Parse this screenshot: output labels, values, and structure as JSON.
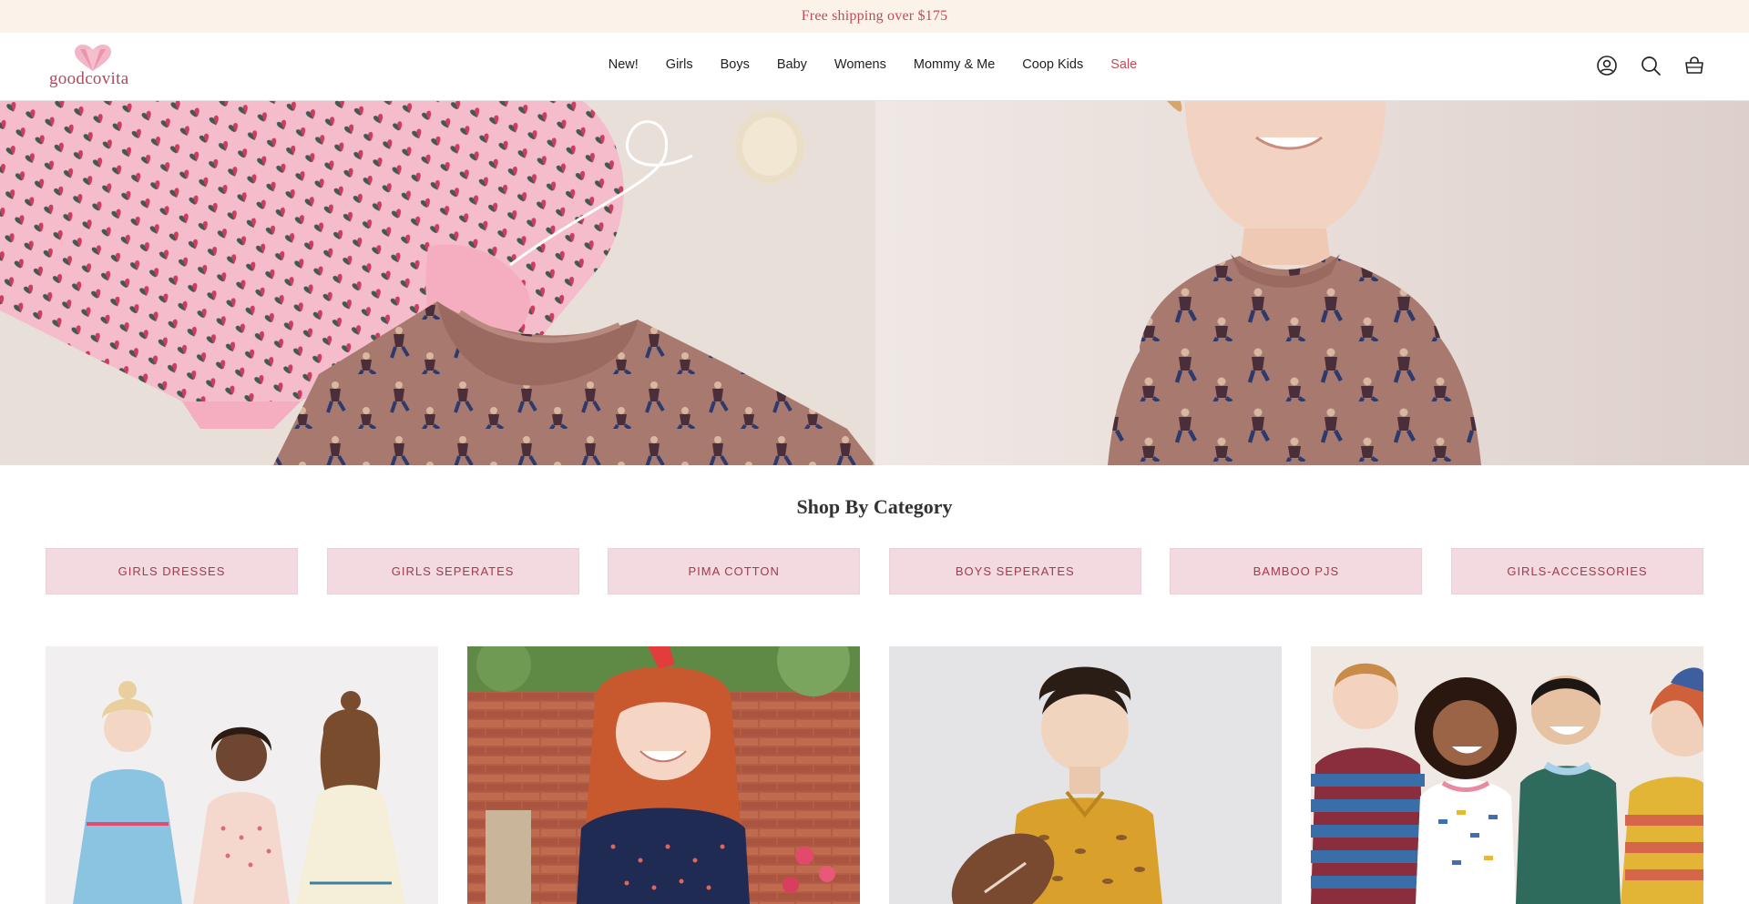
{
  "announcement": {
    "text": "Free shipping over $175"
  },
  "brand": {
    "name": "goodcovita",
    "accent": "#c44a58",
    "logo_color": "#b5485a"
  },
  "nav": {
    "items": [
      {
        "label": "New!"
      },
      {
        "label": "Girls"
      },
      {
        "label": "Boys"
      },
      {
        "label": "Baby"
      },
      {
        "label": "Womens"
      },
      {
        "label": "Mommy & Me"
      },
      {
        "label": "Coop Kids"
      },
      {
        "label": "Sale"
      }
    ]
  },
  "header_icons": [
    "account-icon",
    "search-icon",
    "cart-icon"
  ],
  "category": {
    "title": "Shop By Category",
    "buttons": [
      {
        "label": "GIRLS DRESSES"
      },
      {
        "label": "GIRLS SEPERATES"
      },
      {
        "label": "PIMA COTTON"
      },
      {
        "label": "BOYS SEPERATES"
      },
      {
        "label": "BAMBOO PJS"
      },
      {
        "label": "GIRLS-ACCESSORIES"
      }
    ],
    "button_bg": "#f3d9e0"
  }
}
